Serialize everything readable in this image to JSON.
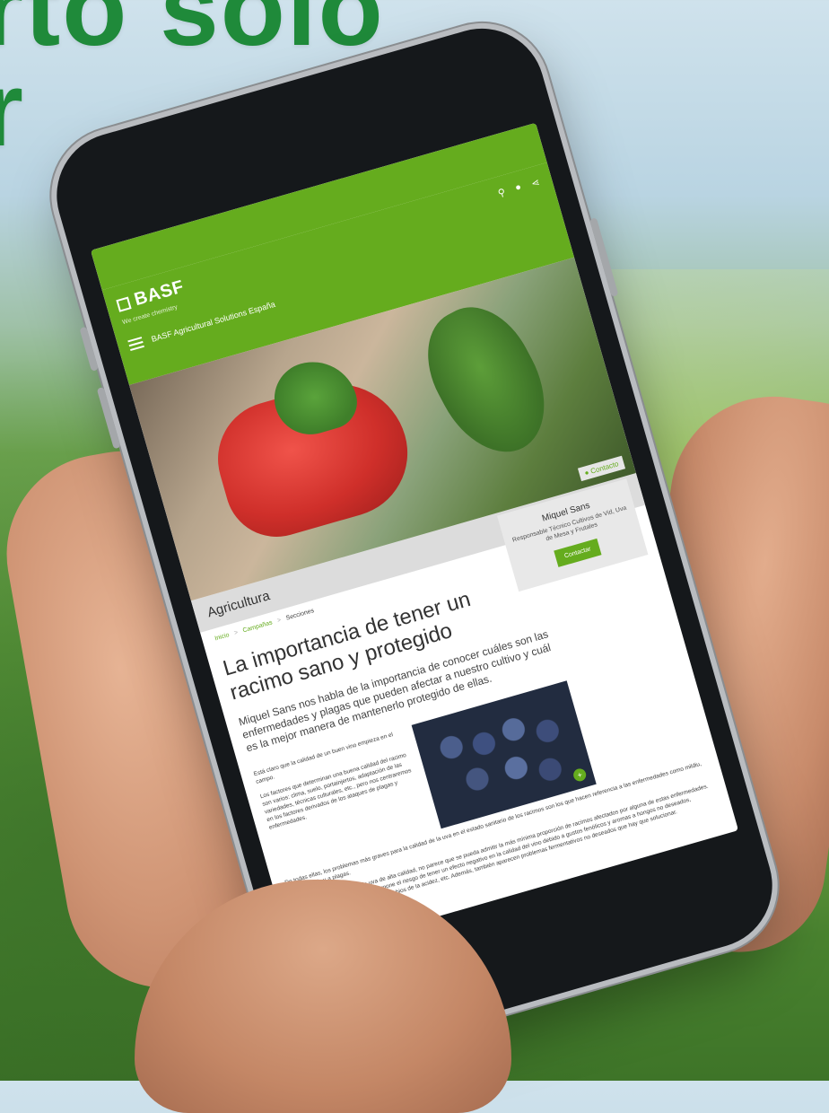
{
  "headline": {
    "line1": "rto solo",
    "line2": "r"
  },
  "colors": {
    "brand_green": "#65ac1e",
    "headline_green": "#1f8a3a"
  },
  "site": {
    "logo": "BASF",
    "tagline": "We create chemistry",
    "name": "BASF Agricultural Solutions España",
    "icons": [
      "search-icon",
      "globe-icon",
      "share-icon"
    ],
    "contact_badge": "Contacto",
    "section": "Agricultura"
  },
  "breadcrumb": {
    "home": "Inicio",
    "sep1": ">",
    "parent": "Campañas",
    "sep2": ">",
    "current": "Secciones"
  },
  "author": {
    "name": "Miquel Sans",
    "role": "Responsable Técnico Cultivos de Vid, Uva de Mesa y Frutales",
    "button": "Contactar"
  },
  "article": {
    "title": "La importancia de tener un racimo sano y protegido",
    "lead": "Miquel Sans nos habla de la importancia de conocer cuáles son las enfermedades y plagas que pueden afectar a nuestro cultivo y cuál es la mejor manera de mantenerlo protegido de ellas.",
    "p1": "Está claro que la calidad de un buen vino empieza en el campo.",
    "p2": "Los factores que determinan una buena calidad del racimo son varios: clima, suelo, portainjertos, adaptación de las variedades, técnicas culturales, etc., pero nos centraremos en los factores derivados de los ataques de plagas y enfermedades.",
    "p3": "De todas ellas, los problemas más graves para la calidad de la uva en el estado sanitario de los racimos son los que hacen referencia a las enfermedades como mildiu, oídio y botritis y a plagas.",
    "p4": "Pensando en la producción de uva de alta calidad, no parece que se pueda admitir la más mínima proporción de racimos afectados por alguna de estas enfermedades. Un ataque de enfermedades nos supone el riesgo de tener un efecto negativo en la calidad del vino debido a gustos fenólicos y aromas a hongos no deseados, disminución de los aromas frutales, cambios de la acidez, etc. Además, también aparecen problemas fermentativos no deseados que hay que solucionar."
  }
}
